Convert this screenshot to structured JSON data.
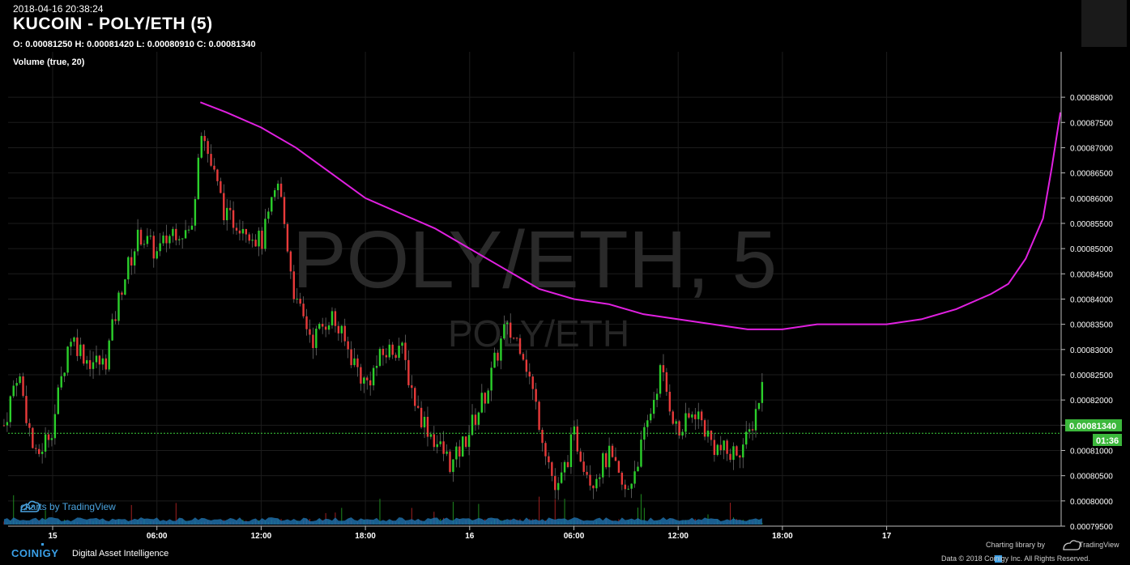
{
  "header": {
    "timestamp": "2018-04-16 20:38:24",
    "title": "KUCOIN - POLY/ETH (5)",
    "ohlc": "O: 0.00081250 H: 0.00081420 L: 0.00080910 C: 0.00081340",
    "volume_label": "Volume (true, 20)"
  },
  "watermark": {
    "main": "POLY/ETH, 5",
    "sub": "POLY/ETH"
  },
  "footer": {
    "brand": "COINIGY",
    "tagline": "Digital Asset Intelligence",
    "tv_credit": "charts by TradingView",
    "charting_by": "Charting library by",
    "tv_name": "TradingView",
    "data_copyright": "Data © 2018   Coinigy Inc. All Rights Reserved."
  },
  "colors": {
    "up": "#2bcf2b",
    "down": "#e83a3a",
    "ma": "#e020e0",
    "price_line": "#3cd03c",
    "volume_fill": "#1f6fa8",
    "accent": "#3aa0e8"
  },
  "icons": [
    "coinigy-logo-icon",
    "tradingview-cloud-icon"
  ],
  "chart_data": {
    "type": "candlestick",
    "title": "KUCOIN - POLY/ETH (5)",
    "ylim": [
      0.000795,
      0.000889
    ],
    "y_ticks": [
      "0.00079500",
      "0.00080000",
      "0.00080500",
      "0.00081000",
      "0.00081500",
      "0.00082000",
      "0.00082500",
      "0.00083000",
      "0.00083500",
      "0.00084000",
      "0.00084500",
      "0.00085000",
      "0.00085500",
      "0.00086000",
      "0.00086500",
      "0.00087000",
      "0.00087500",
      "0.00088000"
    ],
    "x_ticks": [
      "15",
      "06:00",
      "12:00",
      "18:00",
      "16",
      "06:00",
      "12:00",
      "18:00",
      "17"
    ],
    "last_price_label": "0.00081340",
    "countdown_label": "01:36",
    "ma_series": {
      "name": "",
      "x_hours": [
        8.5,
        10,
        12,
        14,
        16,
        18,
        20,
        22,
        24,
        26,
        28,
        30,
        32,
        34,
        36,
        38,
        40,
        42,
        44,
        46,
        48,
        50,
        52,
        54,
        55
      ],
      "values": [
        0.000879,
        0.000877,
        0.000874,
        0.00087,
        0.000865,
        0.00086,
        0.000857,
        0.000854,
        0.00085,
        0.000846,
        0.000842,
        0.00084,
        0.000839,
        0.000837,
        0.000836,
        0.000835,
        0.000834,
        0.000834,
        0.000835,
        0.000835,
        0.000835,
        0.000836,
        0.000838,
        0.000841,
        0.000843
      ],
      "values_tail": {
        "x_hours": [
          56,
          57,
          57.5,
          58
        ],
        "values": [
          0.000848,
          0.000856,
          0.000866,
          0.000877
        ]
      }
    },
    "price_path": {
      "x_hours": [
        -2.8,
        -2,
        -1,
        0,
        1,
        2,
        3,
        4,
        5,
        6,
        7,
        8,
        8.5,
        9,
        10,
        11,
        12,
        13,
        14,
        15,
        16,
        17,
        18,
        19,
        20,
        21,
        22,
        23,
        24,
        25,
        26,
        27,
        28,
        29,
        30,
        31,
        32,
        33,
        34,
        35,
        36,
        37,
        38,
        39,
        40,
        41
      ],
      "values": [
        0.000815,
        0.000826,
        0.000808,
        0.000815,
        0.000833,
        0.000828,
        0.000827,
        0.000843,
        0.000853,
        0.000849,
        0.000854,
        0.000853,
        0.000875,
        0.000868,
        0.000856,
        0.000855,
        0.000851,
        0.000863,
        0.000839,
        0.000832,
        0.000837,
        0.00083,
        0.000823,
        0.000829,
        0.000831,
        0.000818,
        0.000812,
        0.000807,
        0.000814,
        0.000822,
        0.000834,
        0.000831,
        0.000816,
        0.000801,
        0.000813,
        0.000804,
        0.000809,
        0.000801,
        0.000812,
        0.000826,
        0.000813,
        0.000818,
        0.000811,
        0.000809,
        0.000812,
        0.000825
      ]
    },
    "grid": true
  }
}
